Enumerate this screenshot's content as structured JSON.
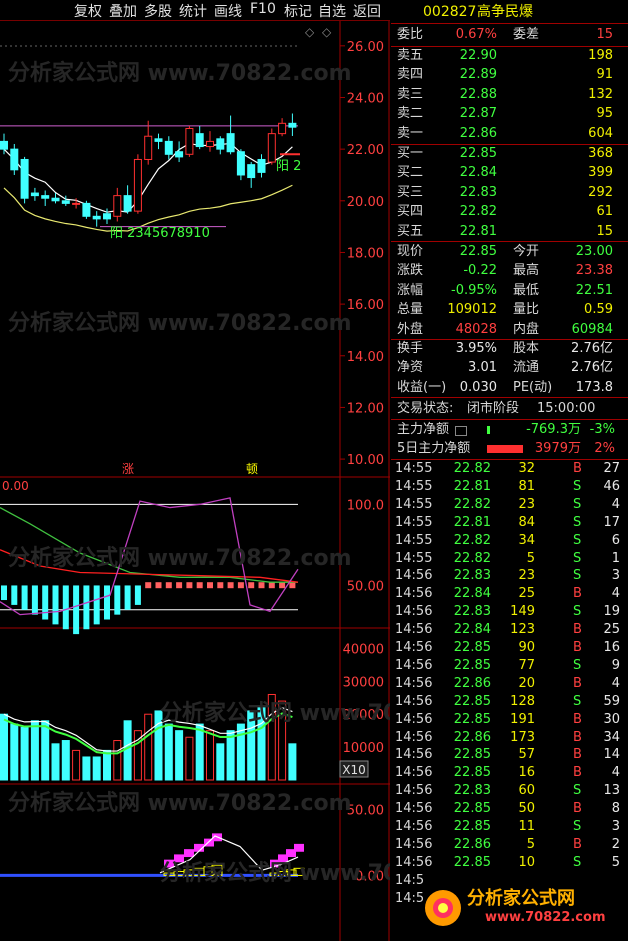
{
  "toolbar": {
    "items": [
      "复权",
      "叠加",
      "多股",
      "统计",
      "画线",
      "F10",
      "标记",
      "自选",
      "返回"
    ]
  },
  "stock": {
    "code": "002827",
    "name": "高争民爆"
  },
  "commission": {
    "ratio_label": "委比",
    "ratio": "0.67%",
    "diff_label": "委差",
    "diff": "15"
  },
  "asks": [
    {
      "label": "卖五",
      "price": "22.90",
      "vol": "198"
    },
    {
      "label": "卖四",
      "price": "22.89",
      "vol": "91"
    },
    {
      "label": "卖三",
      "price": "22.88",
      "vol": "132"
    },
    {
      "label": "卖二",
      "price": "22.87",
      "vol": "95"
    },
    {
      "label": "卖一",
      "price": "22.86",
      "vol": "604"
    }
  ],
  "bids": [
    {
      "label": "买一",
      "price": "22.85",
      "vol": "368"
    },
    {
      "label": "买二",
      "price": "22.84",
      "vol": "399"
    },
    {
      "label": "买三",
      "price": "22.83",
      "vol": "292"
    },
    {
      "label": "买四",
      "price": "22.82",
      "vol": "61"
    },
    {
      "label": "买五",
      "price": "22.81",
      "vol": "15"
    }
  ],
  "quote": {
    "rows": [
      {
        "l1": "现价",
        "v1": "22.85",
        "c1": "green",
        "l2": "今开",
        "v2": "23.00",
        "c2": "green"
      },
      {
        "l1": "涨跌",
        "v1": "-0.22",
        "c1": "green",
        "l2": "最高",
        "v2": "23.38",
        "c2": "red"
      },
      {
        "l1": "涨幅",
        "v1": "-0.95%",
        "c1": "green",
        "l2": "最低",
        "v2": "22.51",
        "c2": "green"
      },
      {
        "l1": "总量",
        "v1": "109012",
        "c1": "yellow",
        "l2": "量比",
        "v2": "0.59",
        "c2": "yellow"
      },
      {
        "l1": "外盘",
        "v1": "48028",
        "c1": "red",
        "l2": "内盘",
        "v2": "60984",
        "c2": "green"
      }
    ]
  },
  "fundamentals": {
    "rows": [
      {
        "l1": "换手",
        "v1": "3.95%",
        "l2": "股本",
        "v2": "2.76亿"
      },
      {
        "l1": "净资",
        "v1": "3.01",
        "l2": "流通",
        "v2": "2.76亿"
      },
      {
        "l1": "收益(一)",
        "v1": "0.030",
        "l2": "PE(动)",
        "v2": "173.8"
      }
    ]
  },
  "trade_status": {
    "label": "交易状态:",
    "value": "闭市阶段",
    "time": "15:00:00"
  },
  "capital_flow": [
    {
      "label": "主力净额",
      "value": "-769.3万",
      "pct": "-3%",
      "color": "green"
    },
    {
      "label": "5日主力净额",
      "value": "3979万",
      "pct": "2%",
      "color": "red"
    }
  ],
  "ticks": [
    {
      "t": "14:55",
      "p": "22.82",
      "v": "32",
      "d": "B",
      "c": "27"
    },
    {
      "t": "14:55",
      "p": "22.81",
      "v": "81",
      "d": "S",
      "c": "46"
    },
    {
      "t": "14:55",
      "p": "22.82",
      "v": "23",
      "d": "S",
      "c": "4"
    },
    {
      "t": "14:55",
      "p": "22.81",
      "v": "84",
      "d": "S",
      "c": "17"
    },
    {
      "t": "14:55",
      "p": "22.82",
      "v": "34",
      "d": "S",
      "c": "6"
    },
    {
      "t": "14:55",
      "p": "22.82",
      "v": "5",
      "d": "S",
      "c": "1"
    },
    {
      "t": "14:56",
      "p": "22.83",
      "v": "23",
      "d": "S",
      "c": "3"
    },
    {
      "t": "14:56",
      "p": "22.84",
      "v": "25",
      "d": "B",
      "c": "4"
    },
    {
      "t": "14:56",
      "p": "22.83",
      "v": "149",
      "d": "S",
      "c": "19"
    },
    {
      "t": "14:56",
      "p": "22.84",
      "v": "123",
      "d": "B",
      "c": "25"
    },
    {
      "t": "14:56",
      "p": "22.85",
      "v": "90",
      "d": "B",
      "c": "16"
    },
    {
      "t": "14:56",
      "p": "22.85",
      "v": "77",
      "d": "S",
      "c": "9"
    },
    {
      "t": "14:56",
      "p": "22.86",
      "v": "20",
      "d": "B",
      "c": "4"
    },
    {
      "t": "14:56",
      "p": "22.85",
      "v": "128",
      "d": "S",
      "c": "59"
    },
    {
      "t": "14:56",
      "p": "22.85",
      "v": "191",
      "d": "B",
      "c": "30"
    },
    {
      "t": "14:56",
      "p": "22.86",
      "v": "173",
      "d": "B",
      "c": "34"
    },
    {
      "t": "14:56",
      "p": "22.85",
      "v": "57",
      "d": "B",
      "c": "14"
    },
    {
      "t": "14:56",
      "p": "22.85",
      "v": "16",
      "d": "B",
      "c": "4"
    },
    {
      "t": "14:56",
      "p": "22.83",
      "v": "60",
      "d": "S",
      "c": "13"
    },
    {
      "t": "14:56",
      "p": "22.85",
      "v": "50",
      "d": "B",
      "c": "8"
    },
    {
      "t": "14:56",
      "p": "22.85",
      "v": "11",
      "d": "S",
      "c": "3"
    },
    {
      "t": "14:56",
      "p": "22.86",
      "v": "5",
      "d": "B",
      "c": "2"
    },
    {
      "t": "14:56",
      "p": "22.85",
      "v": "10",
      "d": "S",
      "c": "5"
    },
    {
      "t": "14:5",
      "p": "",
      "v": "",
      "d": "",
      "c": ""
    },
    {
      "t": "14:5",
      "p": "",
      "v": "",
      "d": "",
      "c": ""
    }
  ],
  "watermark": {
    "text": "分析家公式网 www.70822.com",
    "logo_main": "分析家公式网",
    "logo_url": "www.70822.com"
  },
  "chart_data": [
    {
      "type": "candlestick",
      "title": "",
      "ylim": [
        9.5,
        27.0
      ],
      "y_ticks": [
        "26.00",
        "24.00",
        "22.00",
        "20.00",
        "18.00",
        "16.00",
        "14.00",
        "12.00",
        "10.00"
      ],
      "candles": [
        {
          "o": 22.3,
          "c": 22.0,
          "h": 22.6,
          "l": 21.8
        },
        {
          "o": 22.0,
          "c": 21.2,
          "h": 22.2,
          "l": 21.0
        },
        {
          "o": 21.6,
          "c": 20.1,
          "h": 21.7,
          "l": 19.9
        },
        {
          "o": 20.3,
          "c": 20.2,
          "h": 20.5,
          "l": 20.0
        },
        {
          "o": 20.2,
          "c": 20.1,
          "h": 20.4,
          "l": 19.8
        },
        {
          "o": 20.1,
          "c": 20.0,
          "h": 20.3,
          "l": 19.9
        },
        {
          "o": 20.0,
          "c": 19.9,
          "h": 20.2,
          "l": 19.8
        },
        {
          "o": 19.9,
          "c": 19.9,
          "h": 20.1,
          "l": 19.7
        },
        {
          "o": 19.9,
          "c": 19.4,
          "h": 20.0,
          "l": 19.3
        },
        {
          "o": 19.4,
          "c": 19.3,
          "h": 19.6,
          "l": 19.0
        },
        {
          "o": 19.5,
          "c": 19.3,
          "h": 19.7,
          "l": 19.1
        },
        {
          "o": 19.4,
          "c": 20.2,
          "h": 20.5,
          "l": 19.2
        },
        {
          "o": 20.2,
          "c": 19.6,
          "h": 20.6,
          "l": 19.5
        },
        {
          "o": 19.6,
          "c": 21.6,
          "h": 21.8,
          "l": 19.5
        },
        {
          "o": 21.6,
          "c": 22.5,
          "h": 23.1,
          "l": 21.4
        },
        {
          "o": 22.4,
          "c": 22.3,
          "h": 22.6,
          "l": 22.0
        },
        {
          "o": 22.3,
          "c": 21.8,
          "h": 22.5,
          "l": 21.6
        },
        {
          "o": 21.9,
          "c": 21.7,
          "h": 22.3,
          "l": 21.5
        },
        {
          "o": 21.8,
          "c": 22.8,
          "h": 22.9,
          "l": 21.7
        },
        {
          "o": 22.6,
          "c": 22.1,
          "h": 22.9,
          "l": 22.0
        },
        {
          "o": 22.1,
          "c": 22.3,
          "h": 22.7,
          "l": 21.9
        },
        {
          "o": 22.4,
          "c": 22.0,
          "h": 22.5,
          "l": 21.8
        },
        {
          "o": 22.6,
          "c": 21.9,
          "h": 23.3,
          "l": 21.8
        },
        {
          "o": 21.9,
          "c": 21.0,
          "h": 22.0,
          "l": 20.8
        },
        {
          "o": 21.4,
          "c": 20.9,
          "h": 21.5,
          "l": 20.5
        },
        {
          "o": 21.6,
          "c": 21.1,
          "h": 21.8,
          "l": 20.9
        },
        {
          "o": 21.5,
          "c": 22.6,
          "h": 22.8,
          "l": 21.4
        },
        {
          "o": 22.6,
          "c": 23.0,
          "h": 23.2,
          "l": 22.5
        },
        {
          "o": 23.0,
          "c": 22.85,
          "h": 23.38,
          "l": 22.51
        }
      ],
      "annotations": [
        "阳 2",
        "阳 2345678910"
      ]
    },
    {
      "type": "line",
      "title": "",
      "ylim": [
        25,
        115
      ],
      "y_ticks": [
        "100.0",
        "50.00"
      ],
      "top_left_label": "0.00",
      "markers": [
        "涨",
        "顿"
      ]
    },
    {
      "type": "bar",
      "title": "",
      "ylim": [
        0,
        45000
      ],
      "y_ticks": [
        "40000",
        "30000",
        "20000",
        "10000"
      ],
      "unit_label": "X10",
      "values": [
        20000,
        17000,
        16000,
        18000,
        18000,
        11000,
        12000,
        9000,
        7000,
        7000,
        9000,
        12000,
        18000,
        15000,
        20000,
        21000,
        17000,
        15000,
        13000,
        17000,
        15000,
        11000,
        15000,
        17000,
        21000,
        22000,
        26000,
        24000,
        11000
      ]
    },
    {
      "type": "bar",
      "title": "",
      "ylim": [
        -5,
        65
      ],
      "y_ticks": [
        "50.00",
        "0.00"
      ]
    }
  ]
}
